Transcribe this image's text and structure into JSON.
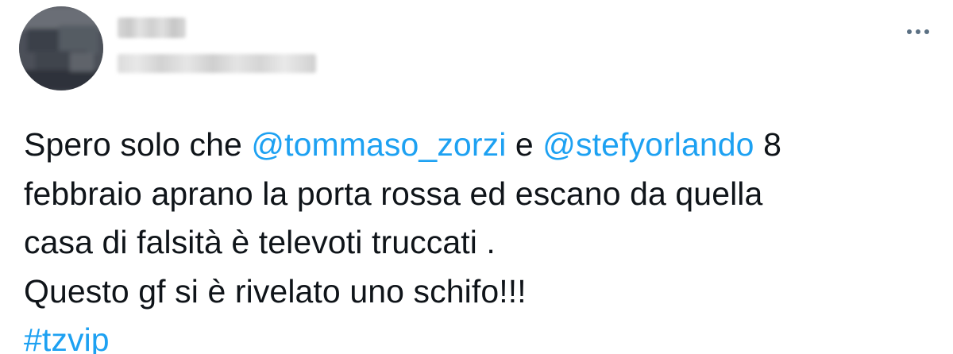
{
  "tweet": {
    "author": {
      "display_name": "",
      "handle": ""
    },
    "more_icon": "ellipsis-horizontal-icon",
    "body": {
      "line1_prefix": "Spero solo che ",
      "mention1": "@tommaso_zorzi",
      "line1_mid": " e ",
      "mention2": "@stefyorlando",
      "line1_suffix": " 8",
      "line2": "febbraio aprano la porta rossa ed escano da quella",
      "line3": "casa di falsità è televoti truccati .",
      "line4": "Questo gf si è rivelato uno schifo!!!",
      "hashtag": "#tzvip"
    }
  },
  "colors": {
    "link": "#1da1f2",
    "text": "#0f1419",
    "icon": "#5b7083"
  }
}
